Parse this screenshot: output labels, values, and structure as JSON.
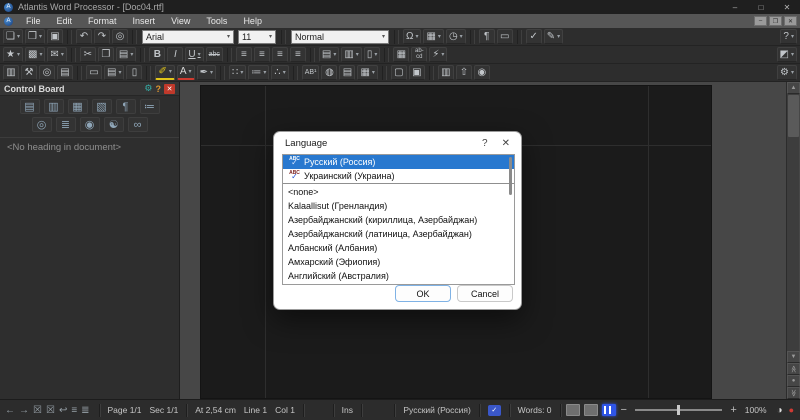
{
  "colors": {
    "selection": "#2878cf",
    "titlebar": "#1f1f1f",
    "menubar": "#565656",
    "toolbar": "#2d2d2d",
    "canvas": "#474747",
    "page": "#1b1b1b",
    "panel_close_red": "#c0392b",
    "status_bell_red": "#d03a34",
    "view_accent_blue": "#2f55e8"
  },
  "window": {
    "title": "Atlantis Word Processor - [Doc04.rtf]",
    "logo": "A",
    "min": "–",
    "max": "□",
    "close": "✕",
    "mdi_min": "–",
    "mdi_restore": "❐",
    "mdi_close": "✕"
  },
  "menu": {
    "items": [
      "File",
      "Edit",
      "Format",
      "Insert",
      "View",
      "Tools",
      "Help"
    ]
  },
  "combos": {
    "font": "Arial",
    "size": "11",
    "style": "Normal"
  },
  "tb1": [
    {
      "n": "new-document",
      "g": "❏"
    },
    {
      "n": "open-document",
      "g": "❒"
    },
    {
      "n": "save",
      "g": "▣"
    },
    {
      "n": "undo",
      "g": "↶"
    },
    {
      "n": "redo",
      "g": "↷"
    },
    {
      "n": "find",
      "g": "◎"
    },
    {
      "n": "insert-symbol",
      "g": "Ω"
    },
    {
      "n": "autocorrect-options",
      "g": "▦"
    },
    {
      "n": "insert-date-time",
      "g": "◷"
    },
    {
      "n": "formatting-marks",
      "g": "¶"
    },
    {
      "n": "full-screen",
      "g": "▭"
    },
    {
      "n": "spellcheck",
      "g": "✓"
    },
    {
      "n": "language-tools",
      "g": "✎"
    },
    {
      "n": "help",
      "g": "?"
    }
  ],
  "tb2": [
    {
      "n": "favorites",
      "g": "★"
    },
    {
      "n": "save-special",
      "g": "▩"
    },
    {
      "n": "send-mail",
      "g": "✉"
    },
    {
      "n": "cut",
      "g": "✂"
    },
    {
      "n": "copy",
      "g": "❐"
    },
    {
      "n": "paste",
      "g": "▤"
    },
    {
      "n": "bold",
      "g": "B"
    },
    {
      "n": "italic",
      "g": "I"
    },
    {
      "n": "underline",
      "g": "U"
    },
    {
      "n": "strikethrough",
      "g": "abc"
    },
    {
      "n": "align-left",
      "g": "≡"
    },
    {
      "n": "align-center",
      "g": "≡"
    },
    {
      "n": "align-right",
      "g": "≡"
    },
    {
      "n": "justify",
      "g": "≡"
    },
    {
      "n": "copy-formatting",
      "g": "▤"
    },
    {
      "n": "paste-formatting",
      "g": "▥"
    },
    {
      "n": "document-backup",
      "g": "▯"
    },
    {
      "n": "print-copy",
      "g": "▦"
    },
    {
      "n": "hyphenation",
      "g": "ab-\ncd"
    },
    {
      "n": "autoformat",
      "g": "⚡"
    },
    {
      "n": "color-theme",
      "g": "◩"
    }
  ],
  "tb3": [
    {
      "n": "backup-copies",
      "g": "▥"
    },
    {
      "n": "document-properties",
      "g": "⚒"
    },
    {
      "n": "print-preview",
      "g": "◎"
    },
    {
      "n": "print",
      "g": "▤"
    },
    {
      "n": "eraser",
      "g": "▭"
    },
    {
      "n": "page-setup",
      "g": "▤"
    },
    {
      "n": "styles-sheet",
      "g": "▯"
    },
    {
      "n": "highlighter",
      "g": "✐"
    },
    {
      "n": "font-color",
      "g": "A"
    },
    {
      "n": "format-painter",
      "g": "✒"
    },
    {
      "n": "bullets",
      "g": "∷"
    },
    {
      "n": "numbering",
      "g": "≔"
    },
    {
      "n": "outline-numbering",
      "g": "∴"
    },
    {
      "n": "footnote",
      "g": "AB¹"
    },
    {
      "n": "browse-object",
      "g": "◍"
    },
    {
      "n": "insert-field",
      "g": "▤"
    },
    {
      "n": "insert-table",
      "g": "▦"
    },
    {
      "n": "text-frame",
      "g": "▢"
    },
    {
      "n": "shading",
      "g": "▣"
    },
    {
      "n": "columns",
      "g": "▥"
    },
    {
      "n": "insert-object",
      "g": "⇧"
    },
    {
      "n": "screenshot",
      "g": "◉"
    },
    {
      "n": "options",
      "g": "⚙"
    }
  ],
  "control_board": {
    "title": "Control Board",
    "gear": "⚙",
    "help": "?",
    "close": "✕",
    "icons_row1": [
      {
        "n": "headings-pane",
        "g": "▤"
      },
      {
        "n": "styles-pane",
        "g": "▥"
      },
      {
        "n": "fields-pane",
        "g": "▦"
      },
      {
        "n": "bookmarks-pane",
        "g": "▧"
      },
      {
        "n": "typography-pane",
        "g": "¶"
      },
      {
        "n": "outline-pane",
        "g": "≔"
      }
    ],
    "icons_row2": [
      {
        "n": "zoom-pane",
        "g": "◎"
      },
      {
        "n": "paragraph-pane",
        "g": "≣"
      },
      {
        "n": "search-pane",
        "g": "◉"
      },
      {
        "n": "languages-pane",
        "g": "☯"
      },
      {
        "n": "attachments-pane",
        "g": "∞"
      }
    ],
    "no_heading": "<No heading in document>"
  },
  "scrollbar": {
    "up": "▲",
    "down": "▼",
    "prev_page": "≪",
    "browse": "●",
    "next_page": "≫"
  },
  "dialog": {
    "title": "Language",
    "help": "?",
    "close": "✕",
    "spell_abc": "ABC",
    "spell_check": "✓",
    "items": [
      {
        "label": "Русский (Россия)"
      },
      {
        "label": "Украинский (Украина)"
      },
      {
        "label": "<none>"
      },
      {
        "label": "Kalaallisut (Гренландия)"
      },
      {
        "label": "Азербайджанский (кириллица, Азербайджан)"
      },
      {
        "label": "Азербайджанский (латиница, Азербайджан)"
      },
      {
        "label": "Албанский (Албания)"
      },
      {
        "label": "Амхарский (Эфиопия)"
      },
      {
        "label": "Английский (Австралия)"
      }
    ],
    "ok": "OK",
    "cancel": "Cancel"
  },
  "status": {
    "nav": [
      {
        "n": "back",
        "g": "←"
      },
      {
        "n": "forward",
        "g": "→"
      },
      {
        "n": "clear-marker",
        "g": "☒"
      },
      {
        "n": "clear-all-markers",
        "g": "☒"
      },
      {
        "n": "undo-jump",
        "g": "↩"
      },
      {
        "n": "goto-start",
        "g": "≡"
      },
      {
        "n": "goto-end",
        "g": "≣"
      }
    ],
    "page": "Page 1/1",
    "sec": "Sec 1/1",
    "at": "At 2,54 cm",
    "line": "Line 1",
    "col": "Col 1",
    "ins": "Ins",
    "language": "Русский (Россия)",
    "spell_indicator": "✓",
    "words": "Words: 0",
    "zoom_out": "−",
    "zoom_in": "+",
    "zoom": "100%",
    "contrast": "◑",
    "bell": "●"
  }
}
